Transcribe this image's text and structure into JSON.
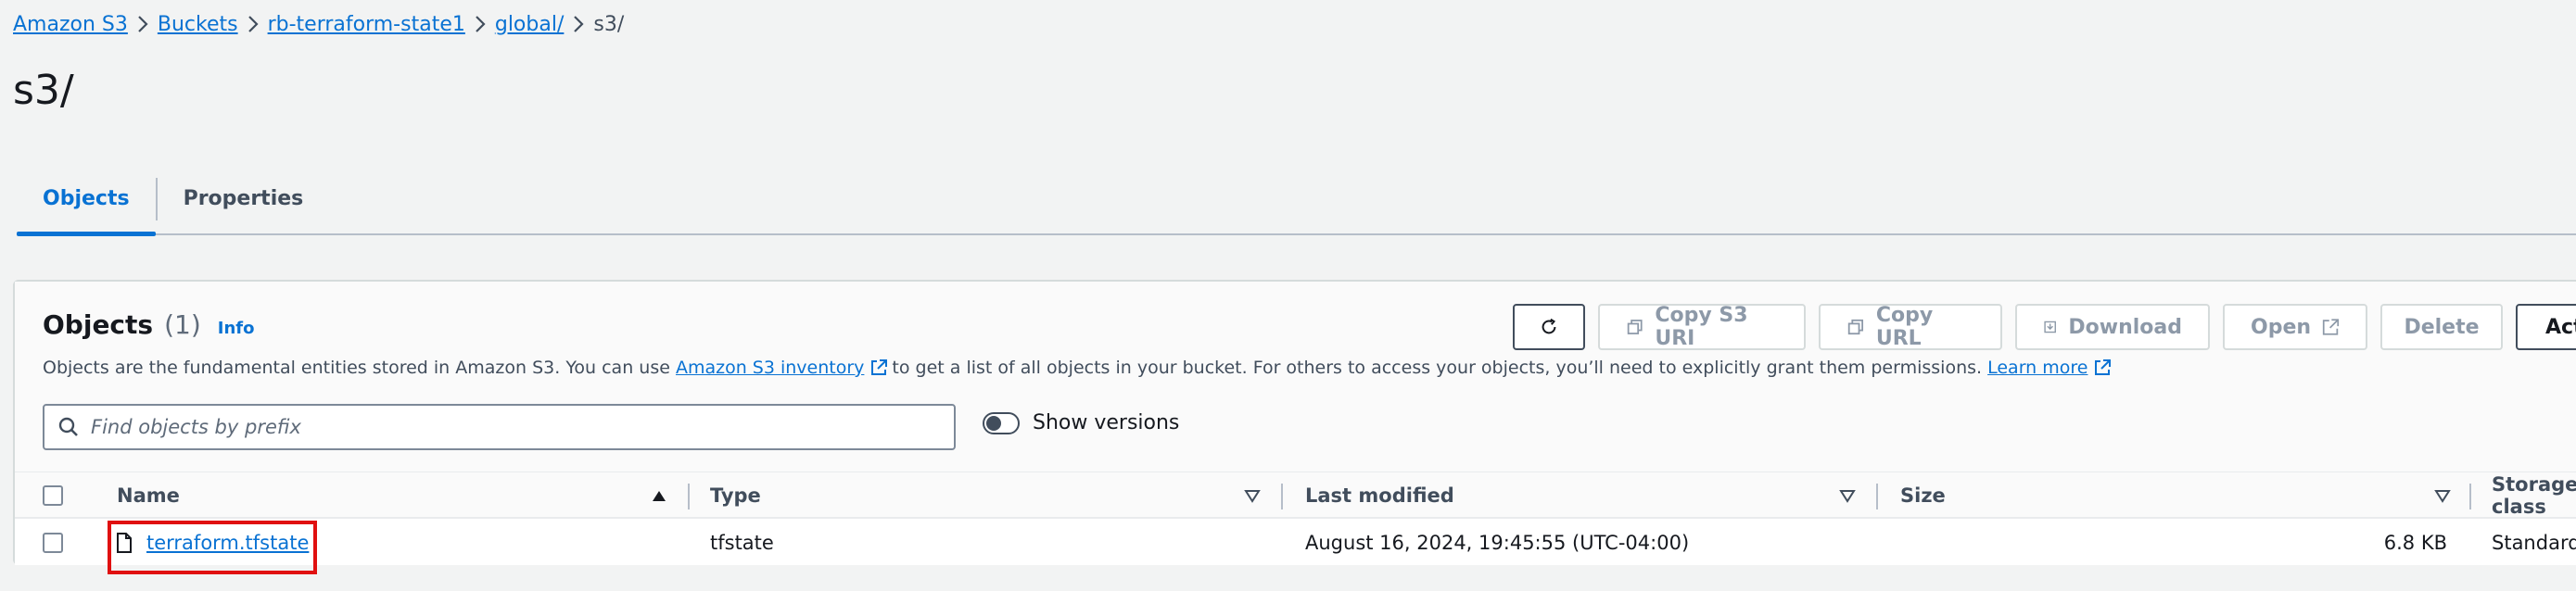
{
  "breadcrumb": {
    "items": [
      "Amazon S3",
      "Buckets",
      "rb-terraform-state1",
      "global/"
    ],
    "current": "s3/"
  },
  "page": {
    "title": "s3/"
  },
  "tabs": [
    {
      "label": "Objects",
      "active": true
    },
    {
      "label": "Properties",
      "active": false
    }
  ],
  "objects": {
    "heading": "Objects",
    "count": "(1)",
    "info_link": "Info",
    "description": {
      "part1": "Objects are the fundamental entities stored in Amazon S3. You can use",
      "inventory_link": "Amazon S3 inventory",
      "part2": "to get a list of all objects in your bucket. For others to access your objects, you’ll need to explicitly grant them permissions.",
      "learn_more": "Learn more"
    },
    "actions": {
      "copy_s3_uri": "Copy S3 URI",
      "copy_url": "Copy URL",
      "download": "Download",
      "open": "Open",
      "delete": "Delete",
      "actions": "Actions"
    },
    "search": {
      "placeholder": "Find objects by prefix",
      "value": ""
    },
    "show_versions": {
      "label": "Show versions",
      "on": false
    }
  },
  "table": {
    "columns": [
      "Name",
      "Type",
      "Last modified",
      "Size",
      "Storage class"
    ],
    "rows": [
      {
        "name": "terraform.tfstate",
        "type": "tfstate",
        "last_modified": "August 16, 2024, 19:45:55 (UTC-04:00)",
        "size": "6.8 KB",
        "storage_class": "Standard"
      }
    ]
  },
  "colors": {
    "accent": "#0972d3",
    "highlight": "#e01010",
    "text": "#16191f",
    "muted": "#414d5c"
  },
  "icons": [
    "chevron-right-icon",
    "refresh-icon",
    "copy-icon",
    "download-icon",
    "external-link-icon",
    "search-icon",
    "sort-asc-icon",
    "sort-desc-icon",
    "file-icon",
    "checkbox"
  ]
}
